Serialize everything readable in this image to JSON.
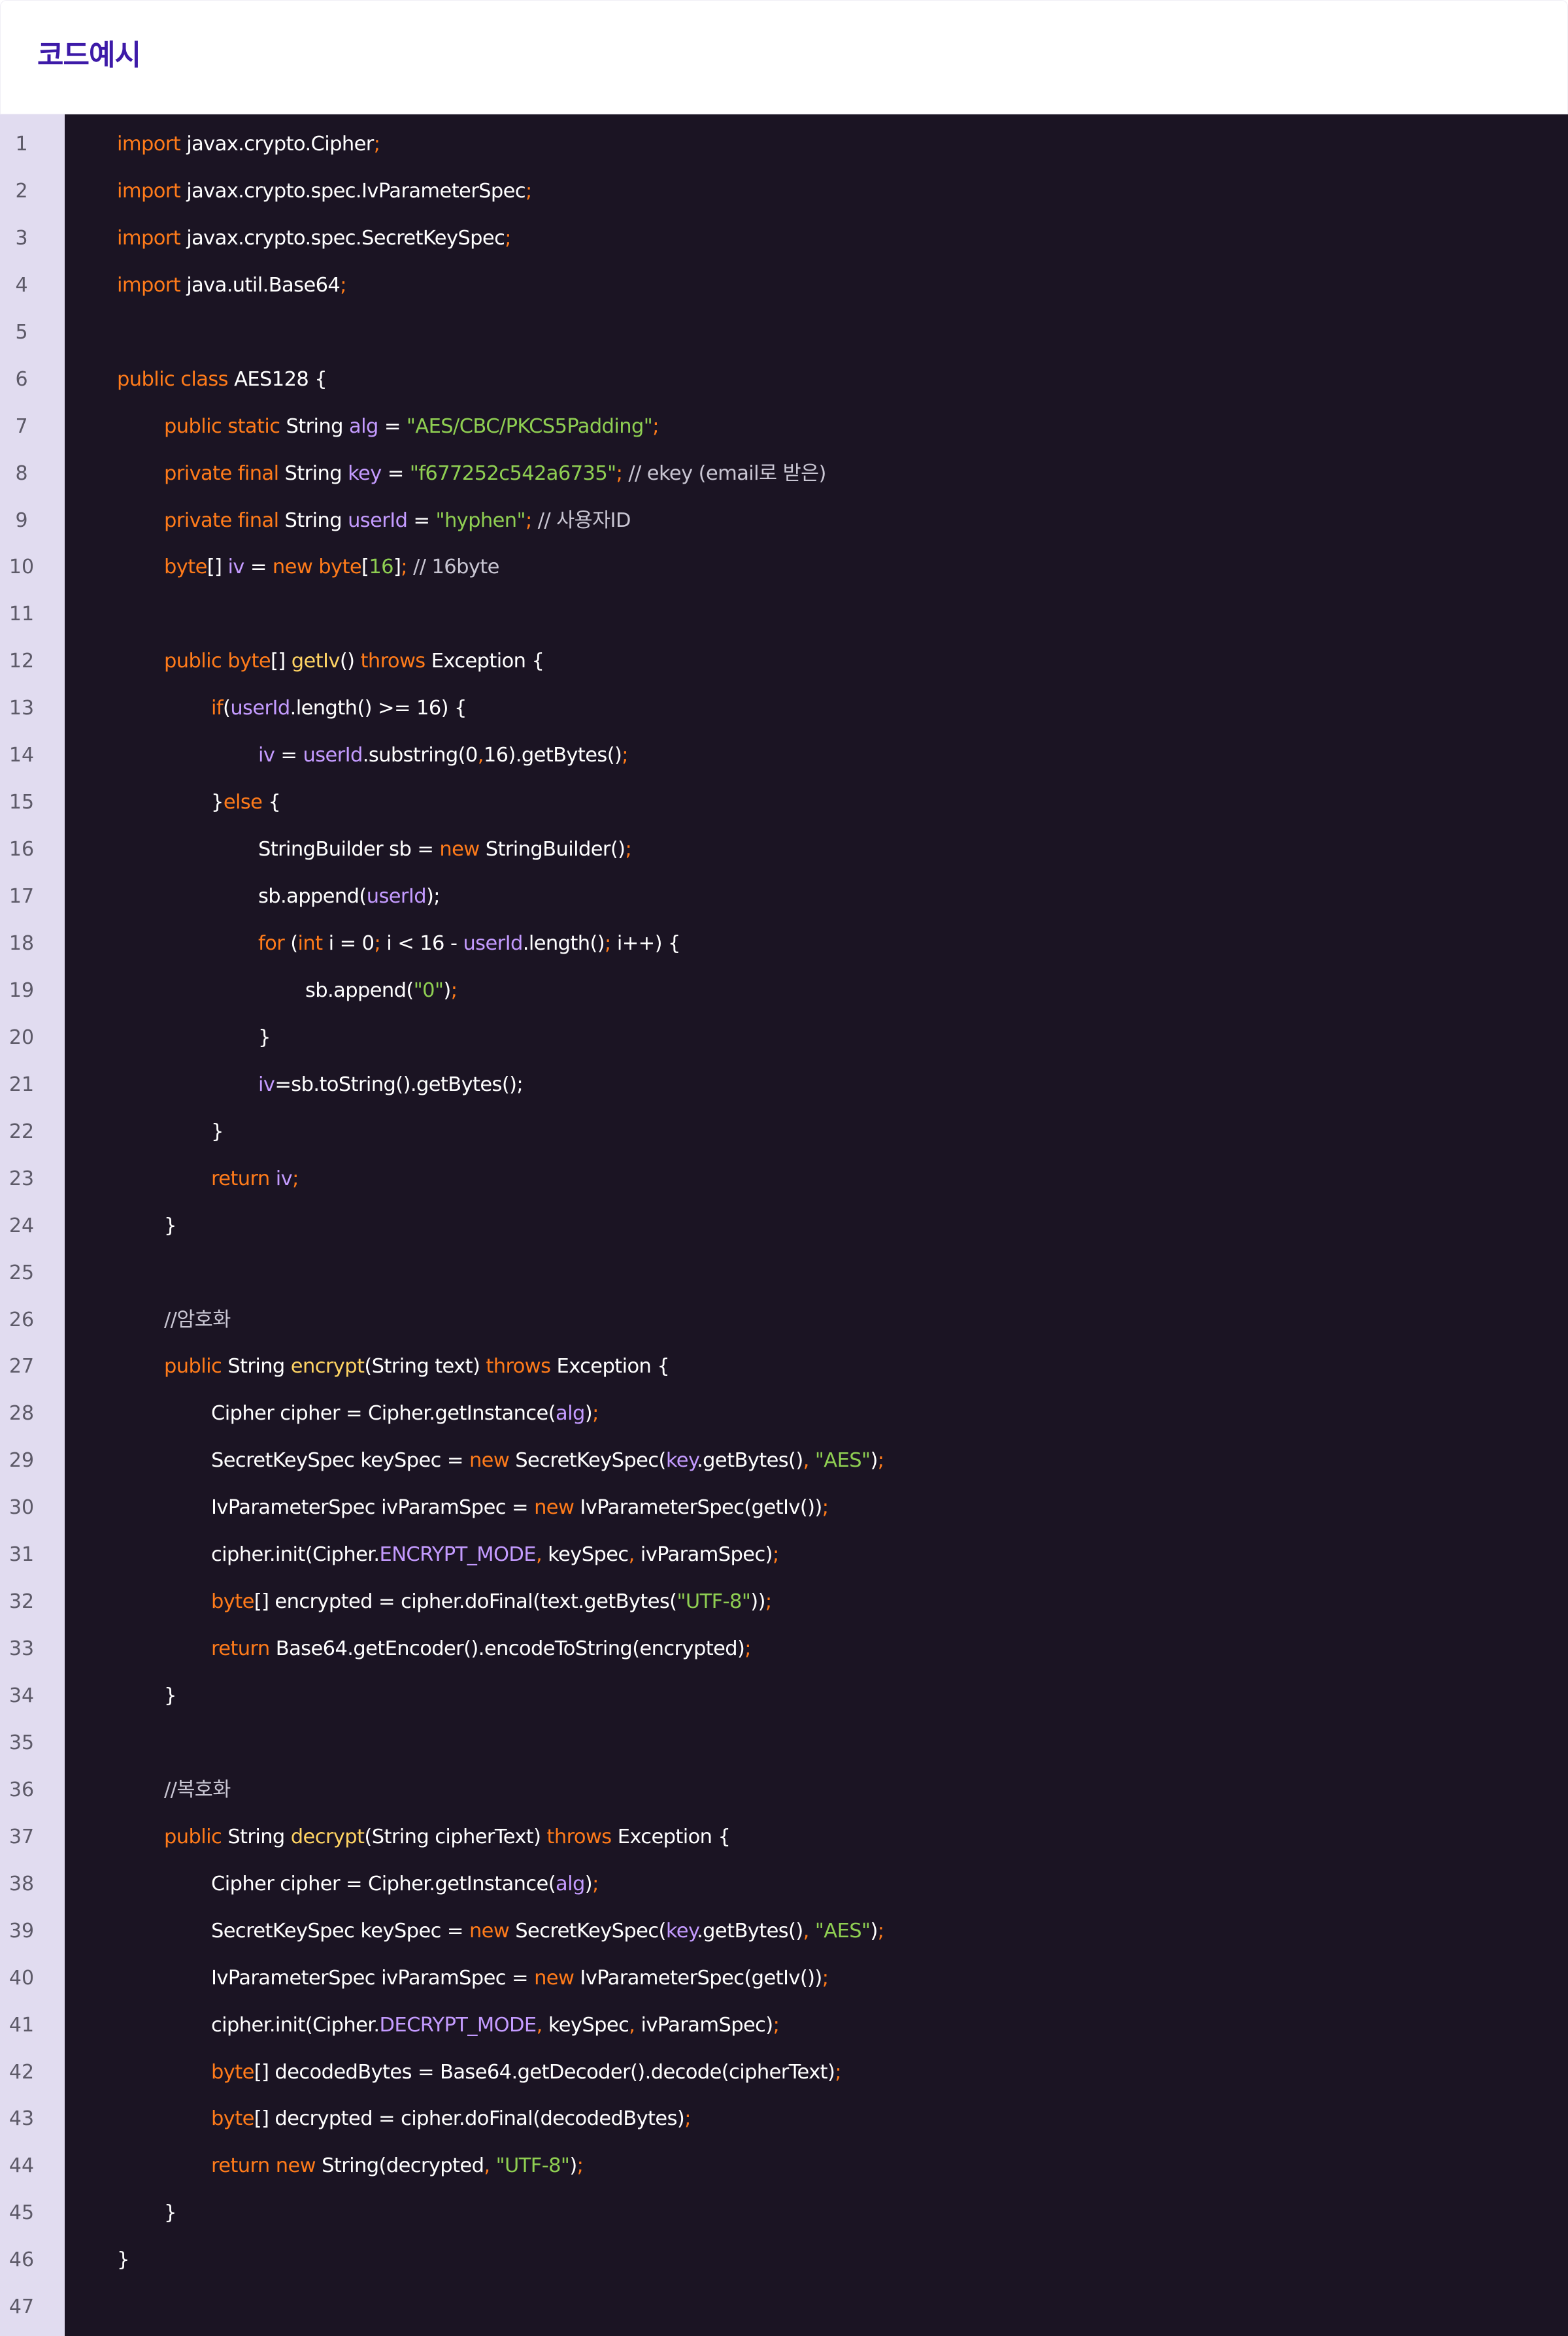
{
  "title": "코드예시",
  "colors": {
    "title": "#3d1aa8",
    "editor_background": "#1b1423",
    "gutter_background": "#e1dcf0",
    "line_number": "#5d5a68",
    "plain": "#ffffff",
    "keyword": "#ff7b1a",
    "string": "#8fcf52",
    "variable": "#c49bff",
    "function": "#ffd463",
    "comment": "#c9c6d3"
  },
  "code_lines": [
    {
      "n": "1",
      "indent": 0,
      "tokens": [
        [
          "kw",
          "import"
        ],
        [
          "pl",
          " javax.crypto.Cipher"
        ],
        [
          "pn",
          ";"
        ]
      ]
    },
    {
      "n": "2",
      "indent": 0,
      "tokens": [
        [
          "kw",
          "import"
        ],
        [
          "pl",
          " javax.crypto.spec.IvParameterSpec"
        ],
        [
          "pn",
          ";"
        ]
      ]
    },
    {
      "n": "3",
      "indent": 0,
      "tokens": [
        [
          "kw",
          "import"
        ],
        [
          "pl",
          " javax.crypto.spec.SecretKeySpec"
        ],
        [
          "pn",
          ";"
        ]
      ]
    },
    {
      "n": "4",
      "indent": 0,
      "tokens": [
        [
          "kw",
          "import"
        ],
        [
          "pl",
          " java.util.Base64"
        ],
        [
          "pn",
          ";"
        ]
      ]
    },
    {
      "n": "5",
      "indent": 0,
      "tokens": []
    },
    {
      "n": "6",
      "indent": 0,
      "tokens": [
        [
          "kw",
          "public class"
        ],
        [
          "pl",
          " AES128 {"
        ]
      ]
    },
    {
      "n": "7",
      "indent": 1,
      "tokens": [
        [
          "kw",
          "public static"
        ],
        [
          "pl",
          " String "
        ],
        [
          "var",
          "alg"
        ],
        [
          "pl",
          " = "
        ],
        [
          "str",
          "\"AES/CBC/PKCS5Padding\""
        ],
        [
          "pn",
          ";"
        ]
      ]
    },
    {
      "n": "8",
      "indent": 1,
      "tokens": [
        [
          "kw",
          "private final"
        ],
        [
          "pl",
          " String "
        ],
        [
          "var",
          "key"
        ],
        [
          "pl",
          " = "
        ],
        [
          "str",
          "\"f677252c542a6735\""
        ],
        [
          "pn",
          ";"
        ],
        [
          "cm",
          " // ekey (email로 받은)"
        ]
      ]
    },
    {
      "n": "9",
      "indent": 1,
      "tokens": [
        [
          "kw",
          "private final"
        ],
        [
          "pl",
          " String "
        ],
        [
          "var",
          "userId"
        ],
        [
          "pl",
          " = "
        ],
        [
          "str",
          "\"hyphen\""
        ],
        [
          "pn",
          ";"
        ],
        [
          "cm",
          " // 사용자ID"
        ]
      ]
    },
    {
      "n": "10",
      "indent": 1,
      "tokens": [
        [
          "kw",
          "byte"
        ],
        [
          "pl",
          "[] "
        ],
        [
          "var",
          "iv"
        ],
        [
          "pl",
          " = "
        ],
        [
          "kw",
          "new byte"
        ],
        [
          "pl",
          "["
        ],
        [
          "str",
          "16"
        ],
        [
          "pl",
          "]"
        ],
        [
          "pn",
          ";"
        ],
        [
          "cm",
          " // 16byte"
        ]
      ]
    },
    {
      "n": "11",
      "indent": 0,
      "tokens": []
    },
    {
      "n": "12",
      "indent": 1,
      "tokens": [
        [
          "kw",
          "public byte"
        ],
        [
          "pl",
          "[] "
        ],
        [
          "fn",
          "getIv"
        ],
        [
          "pl",
          "() "
        ],
        [
          "kw",
          "throws"
        ],
        [
          "pl",
          " Exception {"
        ]
      ]
    },
    {
      "n": "13",
      "indent": 2,
      "tokens": [
        [
          "kw",
          "if"
        ],
        [
          "pl",
          "("
        ],
        [
          "var",
          "userId"
        ],
        [
          "pl",
          ".length() >= 16) {"
        ]
      ]
    },
    {
      "n": "14",
      "indent": 3,
      "tokens": [
        [
          "var",
          "iv"
        ],
        [
          "pl",
          " = "
        ],
        [
          "var",
          "userId"
        ],
        [
          "pl",
          ".substring(0"
        ],
        [
          "pn",
          ","
        ],
        [
          "pl",
          "16).getBytes()"
        ],
        [
          "pn",
          ";"
        ]
      ]
    },
    {
      "n": "15",
      "indent": 2,
      "tokens": [
        [
          "pl",
          "}"
        ],
        [
          "kw",
          "else"
        ],
        [
          "pl",
          " {"
        ]
      ]
    },
    {
      "n": "16",
      "indent": 3,
      "tokens": [
        [
          "pl",
          "StringBuilder sb = "
        ],
        [
          "kw",
          "new"
        ],
        [
          "pl",
          " StringBuilder()"
        ],
        [
          "pn",
          ";"
        ]
      ]
    },
    {
      "n": "17",
      "indent": 3,
      "tokens": [
        [
          "pl",
          "sb.append("
        ],
        [
          "var",
          "userId"
        ],
        [
          "pl",
          ");"
        ]
      ]
    },
    {
      "n": "18",
      "indent": 3,
      "tokens": [
        [
          "kw",
          "for"
        ],
        [
          "pl",
          " ("
        ],
        [
          "kw",
          "int"
        ],
        [
          "pl",
          " i = 0"
        ],
        [
          "pn",
          ";"
        ],
        [
          "pl",
          " i < 16 - "
        ],
        [
          "var",
          "userId"
        ],
        [
          "pl",
          ".length()"
        ],
        [
          "pn",
          ";"
        ],
        [
          "pl",
          " i++) {"
        ]
      ]
    },
    {
      "n": "19",
      "indent": 4,
      "tokens": [
        [
          "pl",
          "sb.append("
        ],
        [
          "str",
          "\"0\""
        ],
        [
          "pl",
          ")"
        ],
        [
          "pn",
          ";"
        ]
      ]
    },
    {
      "n": "20",
      "indent": 3,
      "tokens": [
        [
          "pl",
          "}"
        ]
      ]
    },
    {
      "n": "21",
      "indent": 3,
      "tokens": [
        [
          "var",
          "iv"
        ],
        [
          "pl",
          "=sb.toString().getBytes();"
        ]
      ]
    },
    {
      "n": "22",
      "indent": 2,
      "tokens": [
        [
          "pl",
          "}"
        ]
      ]
    },
    {
      "n": "23",
      "indent": 2,
      "tokens": [
        [
          "kw",
          "return"
        ],
        [
          "pl",
          " "
        ],
        [
          "var",
          "iv"
        ],
        [
          "pn",
          ";"
        ]
      ]
    },
    {
      "n": "24",
      "indent": 1,
      "tokens": [
        [
          "pl",
          "}"
        ]
      ]
    },
    {
      "n": "25",
      "indent": 0,
      "tokens": []
    },
    {
      "n": "26",
      "indent": 1,
      "tokens": [
        [
          "cm",
          "//암호화"
        ]
      ]
    },
    {
      "n": "27",
      "indent": 1,
      "tokens": [
        [
          "kw",
          "public"
        ],
        [
          "pl",
          " String "
        ],
        [
          "fn",
          "encrypt"
        ],
        [
          "pl",
          "(String text) "
        ],
        [
          "kw",
          "throws"
        ],
        [
          "pl",
          " Exception {"
        ]
      ]
    },
    {
      "n": "28",
      "indent": 2,
      "tokens": [
        [
          "pl",
          "Cipher cipher = Cipher.getInstance("
        ],
        [
          "var",
          "alg"
        ],
        [
          "pl",
          ")"
        ],
        [
          "pn",
          ";"
        ]
      ]
    },
    {
      "n": "29",
      "indent": 2,
      "tokens": [
        [
          "pl",
          "SecretKeySpec keySpec = "
        ],
        [
          "kw",
          "new"
        ],
        [
          "pl",
          " SecretKeySpec("
        ],
        [
          "var",
          "key"
        ],
        [
          "pl",
          ".getBytes()"
        ],
        [
          "pn",
          ","
        ],
        [
          "pl",
          " "
        ],
        [
          "str",
          "\"AES\""
        ],
        [
          "pl",
          ")"
        ],
        [
          "pn",
          ";"
        ]
      ]
    },
    {
      "n": "30",
      "indent": 2,
      "tokens": [
        [
          "pl",
          "IvParameterSpec ivParamSpec = "
        ],
        [
          "kw",
          "new"
        ],
        [
          "pl",
          " IvParameterSpec(getIv())"
        ],
        [
          "pn",
          ";"
        ]
      ]
    },
    {
      "n": "31",
      "indent": 2,
      "tokens": [
        [
          "pl",
          "cipher.init(Cipher."
        ],
        [
          "var",
          "ENCRYPT_MODE"
        ],
        [
          "pn",
          ","
        ],
        [
          "pl",
          " keySpec"
        ],
        [
          "pn",
          ","
        ],
        [
          "pl",
          " ivParamSpec)"
        ],
        [
          "pn",
          ";"
        ]
      ]
    },
    {
      "n": "32",
      "indent": 2,
      "tokens": [
        [
          "kw",
          "byte"
        ],
        [
          "pl",
          "[] encrypted = cipher.doFinal(text.getBytes("
        ],
        [
          "str",
          "\"UTF-8\""
        ],
        [
          "pl",
          "))"
        ],
        [
          "pn",
          ";"
        ]
      ]
    },
    {
      "n": "33",
      "indent": 2,
      "tokens": [
        [
          "kw",
          "return"
        ],
        [
          "pl",
          " Base64.getEncoder().encodeToString(encrypted)"
        ],
        [
          "pn",
          ";"
        ]
      ]
    },
    {
      "n": "34",
      "indent": 1,
      "tokens": [
        [
          "pl",
          "}"
        ]
      ]
    },
    {
      "n": "35",
      "indent": 0,
      "tokens": []
    },
    {
      "n": "36",
      "indent": 1,
      "tokens": [
        [
          "cm",
          "//복호화"
        ]
      ]
    },
    {
      "n": "37",
      "indent": 1,
      "tokens": [
        [
          "kw",
          "public"
        ],
        [
          "pl",
          " String "
        ],
        [
          "fn",
          "decrypt"
        ],
        [
          "pl",
          "(String cipherText) "
        ],
        [
          "kw",
          "throws"
        ],
        [
          "pl",
          " Exception {"
        ]
      ]
    },
    {
      "n": "38",
      "indent": 2,
      "tokens": [
        [
          "pl",
          "Cipher cipher = Cipher.getInstance("
        ],
        [
          "var",
          "alg"
        ],
        [
          "pl",
          ")"
        ],
        [
          "pn",
          ";"
        ]
      ]
    },
    {
      "n": "39",
      "indent": 2,
      "tokens": [
        [
          "pl",
          "SecretKeySpec keySpec = "
        ],
        [
          "kw",
          "new"
        ],
        [
          "pl",
          " SecretKeySpec("
        ],
        [
          "var",
          "key"
        ],
        [
          "pl",
          ".getBytes()"
        ],
        [
          "pn",
          ","
        ],
        [
          "pl",
          " "
        ],
        [
          "str",
          "\"AES\""
        ],
        [
          "pl",
          ")"
        ],
        [
          "pn",
          ";"
        ]
      ]
    },
    {
      "n": "40",
      "indent": 2,
      "tokens": [
        [
          "pl",
          "IvParameterSpec ivParamSpec = "
        ],
        [
          "kw",
          "new"
        ],
        [
          "pl",
          " IvParameterSpec(getIv())"
        ],
        [
          "pn",
          ";"
        ]
      ]
    },
    {
      "n": "41",
      "indent": 2,
      "tokens": [
        [
          "pl",
          "cipher.init(Cipher."
        ],
        [
          "var",
          "DECRYPT_MODE"
        ],
        [
          "pn",
          ","
        ],
        [
          "pl",
          " keySpec"
        ],
        [
          "pn",
          ","
        ],
        [
          "pl",
          " ivParamSpec)"
        ],
        [
          "pn",
          ";"
        ]
      ]
    },
    {
      "n": "42",
      "indent": 2,
      "tokens": [
        [
          "kw",
          "byte"
        ],
        [
          "pl",
          "[] decodedBytes = Base64.getDecoder().decode(cipherText)"
        ],
        [
          "pn",
          ";"
        ]
      ]
    },
    {
      "n": "43",
      "indent": 2,
      "tokens": [
        [
          "kw",
          "byte"
        ],
        [
          "pl",
          "[] decrypted = cipher.doFinal(decodedBytes)"
        ],
        [
          "pn",
          ";"
        ]
      ]
    },
    {
      "n": "44",
      "indent": 2,
      "tokens": [
        [
          "kw",
          "return new"
        ],
        [
          "pl",
          " String(decrypted"
        ],
        [
          "pn",
          ","
        ],
        [
          "pl",
          " "
        ],
        [
          "str",
          "\"UTF-8\""
        ],
        [
          "pl",
          ")"
        ],
        [
          "pn",
          ";"
        ]
      ]
    },
    {
      "n": "45",
      "indent": 1,
      "tokens": [
        [
          "pl",
          "}"
        ]
      ]
    },
    {
      "n": "46",
      "indent": 0,
      "tokens": [
        [
          "pl",
          "}"
        ]
      ]
    },
    {
      "n": "47",
      "indent": 0,
      "tokens": []
    }
  ]
}
